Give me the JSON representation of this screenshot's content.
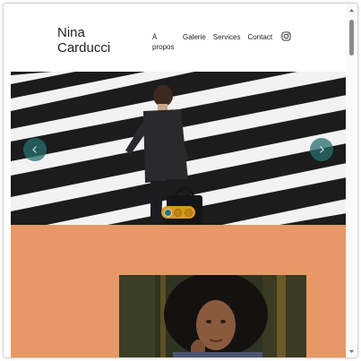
{
  "site": {
    "logo": "Nina Carducci"
  },
  "nav": {
    "items": [
      {
        "label": "À propos"
      },
      {
        "label": "Galerie"
      },
      {
        "label": "Services"
      },
      {
        "label": "Contact"
      }
    ],
    "social_icon": "instagram-icon"
  },
  "carousel": {
    "prev_icon": "chevron-left-icon",
    "next_icon": "chevron-right-icon",
    "slide_count": 3,
    "active_slide": 1,
    "indicator_color": "#d99b1a",
    "arrow_color": "#2f6f74"
  },
  "about": {
    "background_color": "#e89866"
  }
}
